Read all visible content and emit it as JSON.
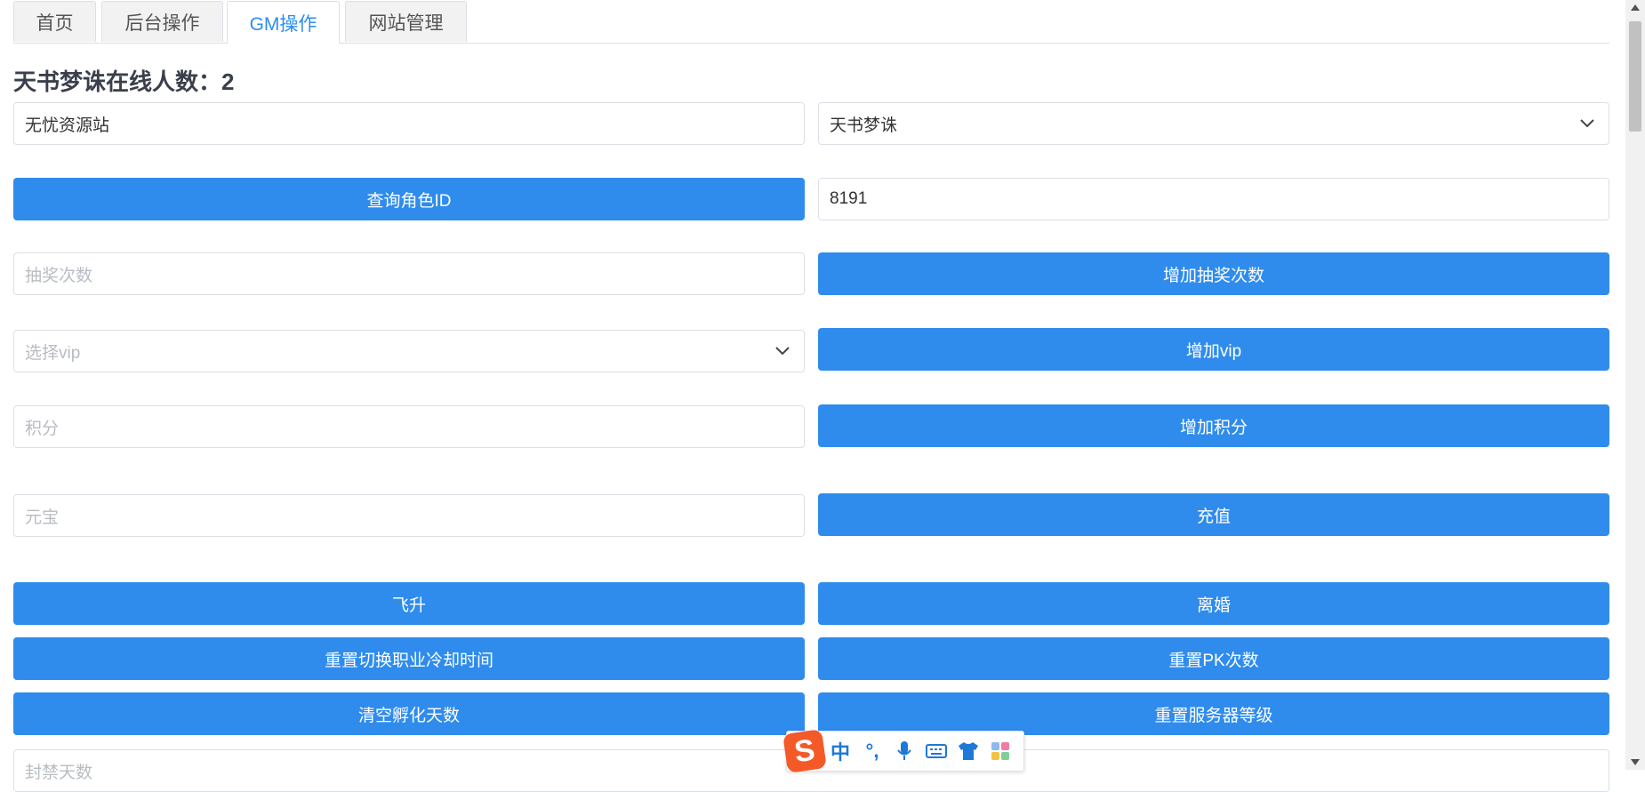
{
  "tabs": [
    {
      "label": "首页"
    },
    {
      "label": "后台操作"
    },
    {
      "label": "GM操作"
    },
    {
      "label": "网站管理"
    }
  ],
  "colors": {
    "accent": "#2f8ced",
    "active_tab": "#2e8ded",
    "ime_brand": "#f35a27"
  },
  "online": {
    "title": "天书梦诛在线人数：2"
  },
  "form": {
    "site_name": {
      "value": "无忧资源站"
    },
    "server_select": {
      "value": "天书梦诛"
    },
    "query_button": "查询角色ID",
    "role_id": {
      "value": "8191"
    },
    "lottery": {
      "placeholder": "抽奖次数",
      "button": "增加抽奖次数"
    },
    "vip": {
      "placeholder": "选择vip",
      "button": "增加vip"
    },
    "points": {
      "placeholder": "积分",
      "button": "增加积分"
    },
    "yuanbao": {
      "placeholder": "元宝",
      "button": "充值"
    },
    "actions": {
      "ascend": "飞升",
      "divorce": "离婚",
      "reset_class_cooldown": "重置切换职业冷却时间",
      "reset_pk": "重置PK次数",
      "clear_hatch_days": "清空孵化天数",
      "reset_server_level": "重置服务器等级"
    },
    "ban_days": {
      "placeholder": "封禁天数"
    }
  },
  "ime": {
    "logo": "S",
    "mode": "中",
    "punct": "°,",
    "icons": [
      "microphone-icon",
      "keyboard-icon",
      "skin-shirt-icon",
      "toolbox-icon"
    ]
  }
}
